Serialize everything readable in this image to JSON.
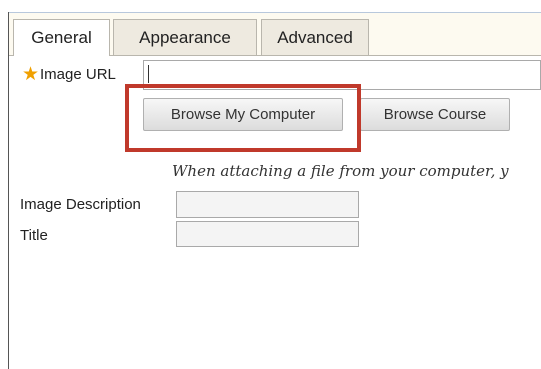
{
  "tabs": [
    {
      "label": "General",
      "active": true
    },
    {
      "label": "Appearance",
      "active": false
    },
    {
      "label": "Advanced",
      "active": false
    }
  ],
  "form": {
    "required_icon": "asterisk-icon",
    "image_url_label": "Image URL",
    "image_url_value": "",
    "browse_computer_label": "Browse My Computer",
    "browse_course_label": "Browse Course",
    "notice_text": "When attaching a file from your computer, y",
    "image_description_label": "Image Description",
    "image_description_value": "",
    "title_label": "Title",
    "title_value": ""
  },
  "colors": {
    "required_star": "#f0a000",
    "highlight_box": "#c0392b",
    "tabstrip_bg": "#fdfaf0"
  }
}
